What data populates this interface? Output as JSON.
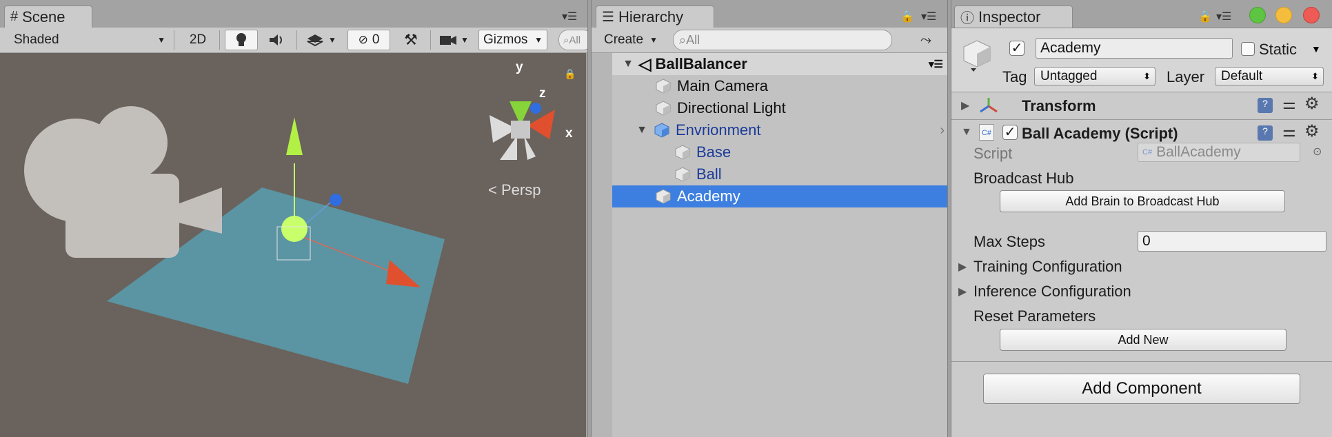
{
  "scene": {
    "tab_label": "Scene",
    "shading_mode": "Shaded",
    "mode_2d": "2D",
    "hidden_count": "0",
    "gizmos_label": "Gizmos",
    "search_placeholder": "All",
    "projection_label": "Persp",
    "axis_x": "x",
    "axis_y": "y",
    "axis_z": "z"
  },
  "hierarchy": {
    "tab_label": "Hierarchy",
    "create_label": "Create",
    "search_placeholder": "All",
    "scene_name": "BallBalancer",
    "items": [
      {
        "label": "Main Camera"
      },
      {
        "label": "Directional Light"
      },
      {
        "label": "Envrionment"
      },
      {
        "label": "Base"
      },
      {
        "label": "Ball"
      },
      {
        "label": "Academy"
      }
    ]
  },
  "inspector": {
    "tab_label": "Inspector",
    "object_name": "Academy",
    "static_label": "Static",
    "tag_label": "Tag",
    "tag_value": "Untagged",
    "layer_label": "Layer",
    "layer_value": "Default",
    "transform_label": "Transform",
    "component_label": "Ball Academy (Script)",
    "script_label": "Script",
    "script_value": "BallAcademy",
    "broadcast_hub_label": "Broadcast Hub",
    "add_brain_button": "Add Brain to Broadcast Hub",
    "max_steps_label": "Max Steps",
    "max_steps_value": "0",
    "training_config_label": "Training Configuration",
    "inference_config_label": "Inference Configuration",
    "reset_params_label": "Reset Parameters",
    "add_new_button": "Add New",
    "add_component_button": "Add Component"
  },
  "colors": {
    "selection": "#3d7fe0",
    "scene_bg": "#6a625c",
    "plane": "#5a9aaa",
    "window_close": "#ee5b55",
    "window_min": "#f5bd3d",
    "window_max": "#5ec543"
  }
}
